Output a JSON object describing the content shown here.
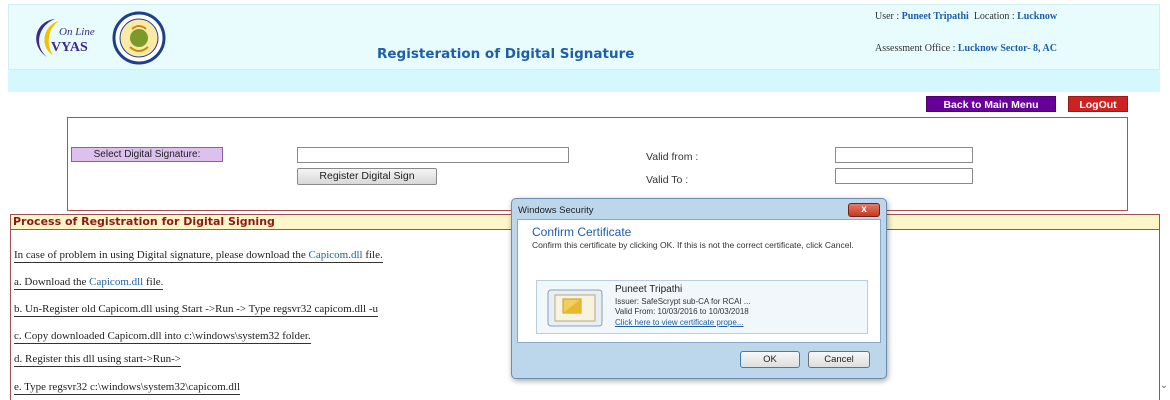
{
  "header": {
    "logo_text": "VYAS",
    "logo_script": "On Line",
    "title": "Registeration of Digital Signature",
    "user_label": "User :",
    "user_name": "Puneet Tripathi",
    "location_label": "Location :",
    "location": "Lucknow",
    "office_label": "Assessment Office :",
    "office": "Lucknow Sector- 8, AC"
  },
  "nav": {
    "main_menu": "Back to Main Menu",
    "logout": "LogOut"
  },
  "registration": {
    "select_signature": "Select Digital Signature:",
    "signature_value": "",
    "register_button": "Register Digital Sign",
    "valid_from_label": "Valid from :",
    "valid_from_value": "",
    "valid_to_label": "Valid To :",
    "valid_to_value": ""
  },
  "process": {
    "heading": "Process of Registration for Digital Signing",
    "intro_before": "In case of problem in using Digital signature, please download the ",
    "intro_link": "Capicom.dll",
    "intro_after": " file.",
    "step_a_before": "a. Download the ",
    "step_a_link": "Capicom.dll",
    "step_a_after": " file.",
    "step_b": "b. Un-Register old Capicom.dll using Start ->Run -> Type regsvr32 capicom.dll -u",
    "step_c": "c. Copy downloaded Capicom.dll into c:\\windows\\system32 folder.",
    "step_d": "d. Register this dll using start->Run->",
    "step_e": "e. Type regsvr32 c:\\windows\\system32\\capicom.dll"
  },
  "dialog": {
    "window_title": "Windows Security",
    "close_label": "x",
    "heading": "Confirm Certificate",
    "message": "Confirm this certificate by clicking OK. If this is not the correct certificate, click Cancel.",
    "cert_name": "Puneet Tripathi",
    "cert_issuer": "Issuer: SafeScrypt sub-CA for RCAI ...",
    "cert_valid": "Valid From: 10/03/2016 to 10/03/2018",
    "cert_link": "Click here to view certificate prope...",
    "ok_label": "OK",
    "cancel_label": "Cancel"
  },
  "colors": {
    "header_bg": "#e8fbfd",
    "title_blue": "#1e5fa8",
    "main_menu_bg": "#660099",
    "logout_bg": "#cc2222",
    "panel_border": "#b05050",
    "process_header_bg": "#fdf6c8",
    "dialog_frame": "#bcd6ec"
  },
  "icons": {
    "logo": "vyas-logo-icon",
    "emblem": "emblem-icon",
    "certificate": "certificate-icon",
    "scroll_down": "chevron-down-icon"
  }
}
